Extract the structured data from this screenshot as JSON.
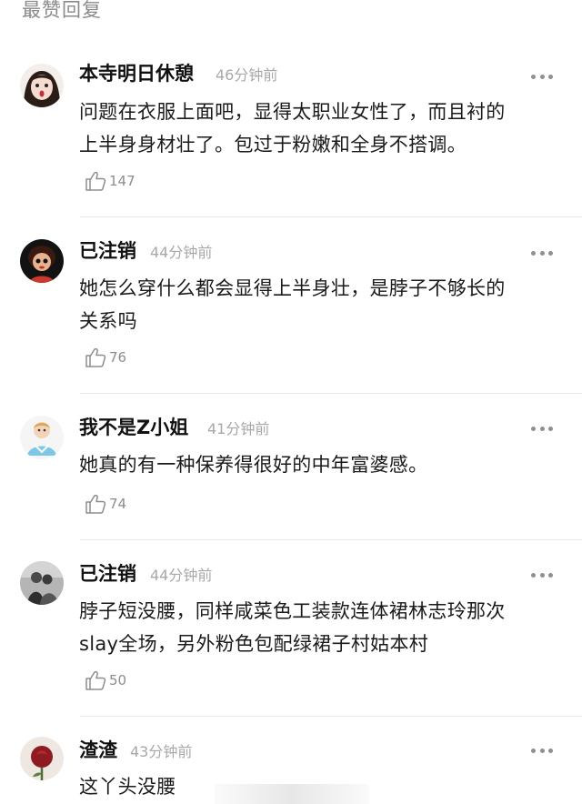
{
  "section": {
    "title": "最赞回复"
  },
  "comments": [
    {
      "username": "本寺明日休憩",
      "time": "46分钟前",
      "text_lines": [
        "问题在衣服上面吧，显得太职业女性了，而且衬的",
        "上半身身材壮了。包过于粉嫩和全身不搭调。"
      ],
      "likes": "147",
      "avatar_icon": "girl-face-avatar"
    },
    {
      "username": "已注销",
      "time": "44分钟前",
      "text_lines": [
        "她怎么穿什么都会显得上半身壮，是脖子不够长的",
        "关系吗"
      ],
      "likes": "76",
      "avatar_icon": "doll-avatar"
    },
    {
      "username": "我不是Z小姐",
      "time": "41分钟前",
      "text_lines": [
        "她真的有一种保养得很好的中年富婆感。"
      ],
      "likes": "74",
      "avatar_icon": "cartoon-girl-avatar"
    },
    {
      "username": "已注销",
      "time": "44分钟前",
      "text_lines": [
        "脖子短没腰，同样咸菜色工装款连体裙林志玲那次",
        "slay全场，另外粉色包配绿裙子村姑本村"
      ],
      "likes": "50",
      "avatar_icon": "couple-photo-avatar"
    },
    {
      "username": "渣渣",
      "time": "43分钟前",
      "text_lines": [
        "这丫头没腰"
      ],
      "likes": "",
      "avatar_icon": "rose-avatar"
    }
  ],
  "icons": {
    "like": "thumbs-up-icon",
    "more": "more-dots-icon"
  },
  "colors": {
    "meta_gray": "#a8a8a8",
    "divider": "#e8e8e8"
  }
}
